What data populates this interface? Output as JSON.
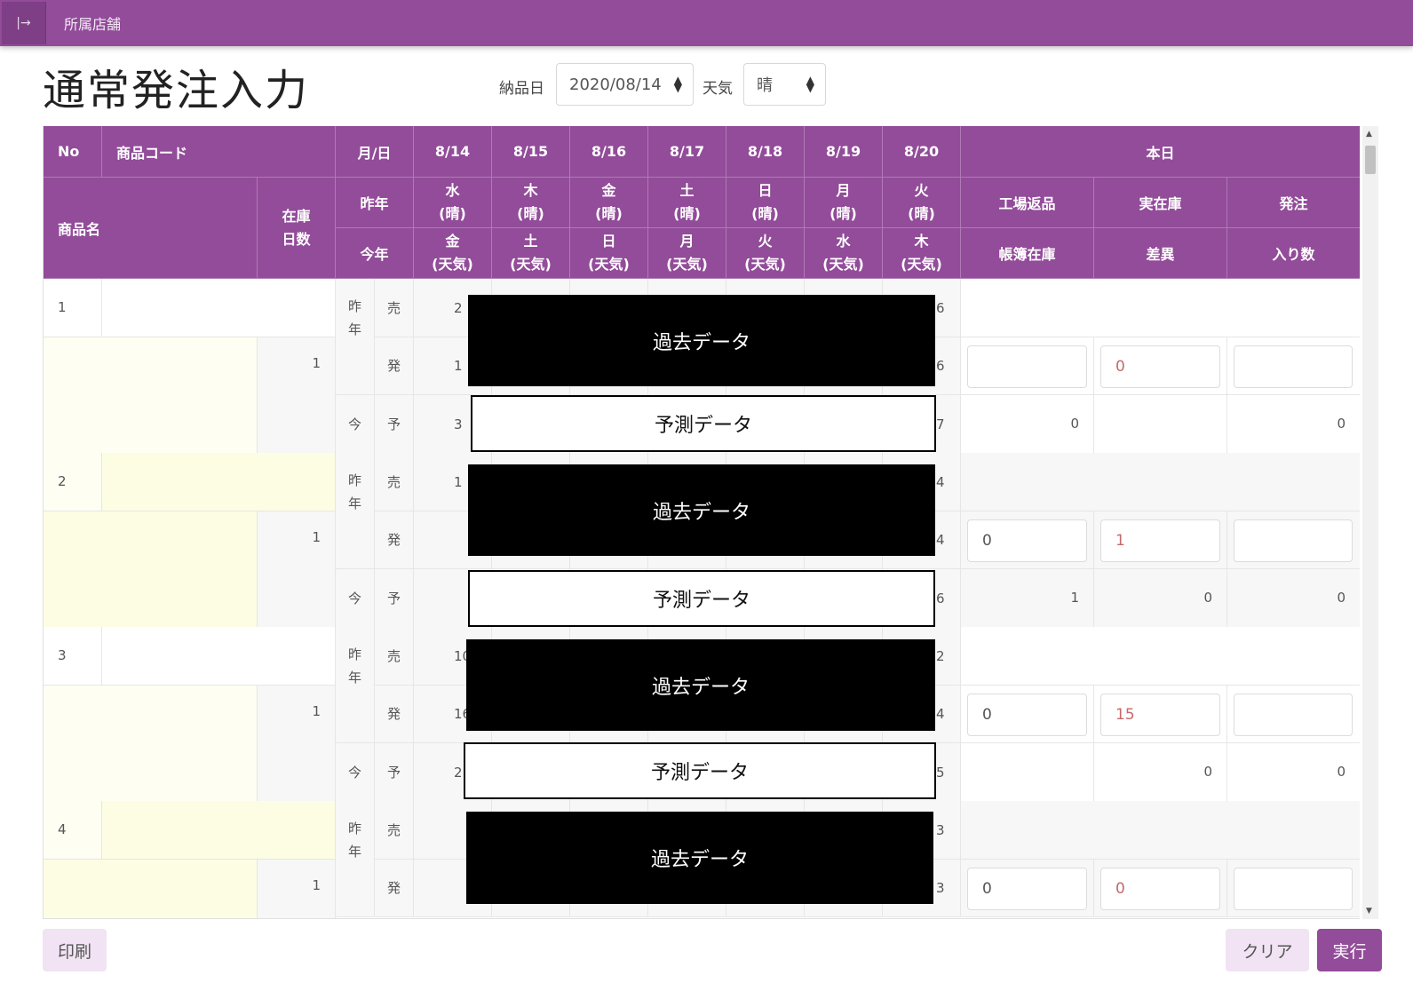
{
  "topbar": {
    "toggle_icon": "sidebar-toggle-icon",
    "store_label": "所属店舗"
  },
  "page": {
    "title": "通常発注入力"
  },
  "controls": {
    "delivery_label": "納品日",
    "delivery_value": "2020/08/14",
    "weather_label": "天気",
    "weather_value": "晴"
  },
  "header": {
    "no": "No",
    "product_code": "商品コード",
    "month_day": "月/日",
    "dates": [
      "8/14",
      "8/15",
      "8/16",
      "8/17",
      "8/18",
      "8/19",
      "8/20"
    ],
    "today": "本日",
    "product_name": "商品名",
    "stock_days_1": "在庫",
    "stock_days_2": "日数",
    "last_year": "昨年",
    "this_year": "今年",
    "last_year_days": [
      [
        "水",
        "(晴)"
      ],
      [
        "木",
        "(晴)"
      ],
      [
        "金",
        "(晴)"
      ],
      [
        "土",
        "(晴)"
      ],
      [
        "日",
        "(晴)"
      ],
      [
        "月",
        "(晴)"
      ],
      [
        "火",
        "(晴)"
      ]
    ],
    "this_year_days": [
      [
        "金",
        "(天気)"
      ],
      [
        "土",
        "(天気)"
      ],
      [
        "日",
        "(天気)"
      ],
      [
        "月",
        "(天気)"
      ],
      [
        "火",
        "(天気)"
      ],
      [
        "水",
        "(天気)"
      ],
      [
        "木",
        "(天気)"
      ]
    ],
    "factory_return": "工場返品",
    "actual_stock": "実在庫",
    "order": "発注",
    "book_stock": "帳簿在庫",
    "difference": "差異",
    "pack_qty": "入り数"
  },
  "labels": {
    "sakunen_1": "昨",
    "sakunen_2": "年",
    "uri": "売",
    "hatsu": "発",
    "kon": "今",
    "yo": "予"
  },
  "rows": [
    {
      "no": "1",
      "stock_days": "1",
      "uri_first": "2",
      "uri_last": "6",
      "hatsu_first": "1",
      "hatsu_last": "6",
      "yo_first": "3",
      "yo_last": "7",
      "factory_return": "",
      "actual_stock": "0",
      "order": "",
      "book_stock": "0",
      "difference": "",
      "pack_qty": "0"
    },
    {
      "no": "2",
      "stock_days": "1",
      "uri_first": "1",
      "uri_last": "4",
      "hatsu_first": "",
      "hatsu_last": "4",
      "yo_first": "",
      "yo_last": "6",
      "factory_return": "0",
      "actual_stock": "1",
      "order": "",
      "book_stock": "1",
      "difference": "0",
      "pack_qty": "0"
    },
    {
      "no": "3",
      "stock_days": "1",
      "uri_first": "10",
      "uri_last": "2",
      "hatsu_first": "16",
      "hatsu_last": "4",
      "yo_first": "2",
      "yo_last": "5",
      "factory_return": "0",
      "actual_stock": "15",
      "order": "",
      "book_stock": "",
      "difference": "0",
      "pack_qty": "0"
    },
    {
      "no": "4",
      "stock_days": "1",
      "uri_first": "",
      "uri_last": "3",
      "hatsu_first": "",
      "hatsu_last": "3",
      "factory_return": "0",
      "actual_stock": "0",
      "order": ""
    }
  ],
  "overlays": {
    "past": "過去データ",
    "forecast": "予測データ"
  },
  "buttons": {
    "print": "印刷",
    "clear": "クリア",
    "execute": "実行"
  },
  "colors": {
    "accent": "#924c99",
    "row_highlight": "#fdfde4"
  }
}
